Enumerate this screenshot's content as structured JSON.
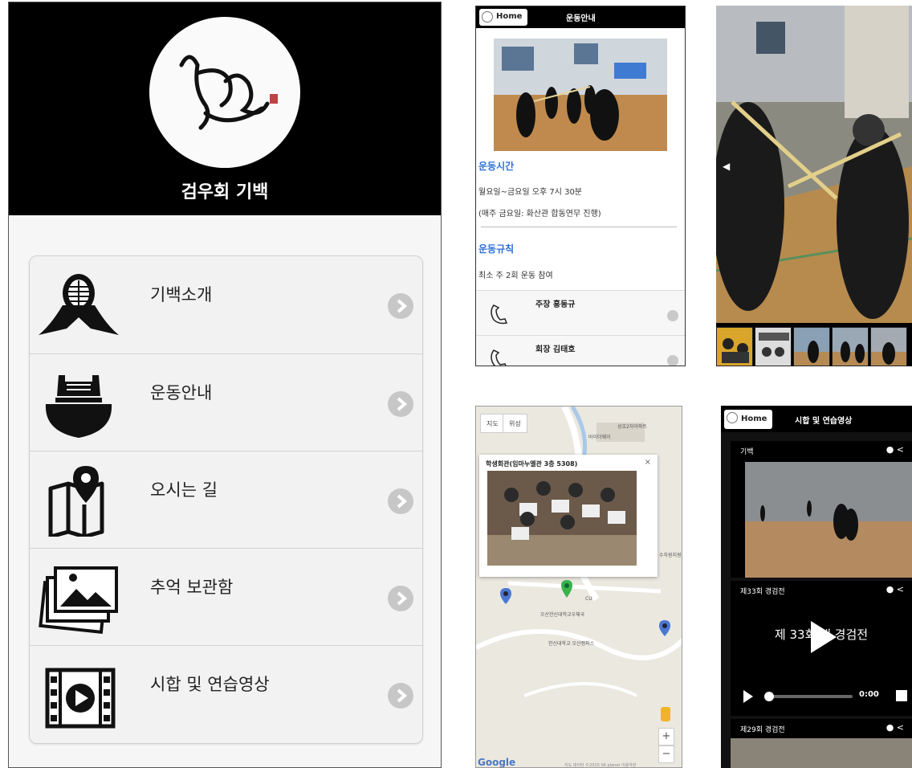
{
  "menu_screen": {
    "club_name": "검우회 기백",
    "items": [
      {
        "label": "기백소개",
        "icon": "kendo-mask-icon"
      },
      {
        "label": "운동안내",
        "icon": "kendo-armor-icon"
      },
      {
        "label": "오시는 길",
        "icon": "map-pin-icon"
      },
      {
        "label": "추억 보관함",
        "icon": "photo-album-icon"
      },
      {
        "label": "시합 및 연습영상",
        "icon": "video-icon"
      }
    ]
  },
  "info_screen": {
    "home_label": "Home",
    "title": "운동안내",
    "time_heading": "운동시간",
    "time_line1": "월요일~금요일 오후 7시 30분",
    "time_line2": "(매주 금요일: 화산관 합동연무 진행)",
    "rule_heading": "운동규칙",
    "rule_line1": "최소 주 2회 운동 참여",
    "contacts": [
      {
        "name": "주장 홍동규"
      },
      {
        "name": "회장 김태호"
      }
    ]
  },
  "gallery_screen": {
    "prev_label": "◀"
  },
  "map_screen": {
    "map_btn": "지도",
    "satellite_btn": "위성",
    "popup_title": "학생회관(임마누엘관 3층 5308)",
    "close": "×",
    "places": {
      "p1": "성호2차아파트",
      "p2": "바이더웨이",
      "p3": "CU",
      "p4": "오산한신대학교우체국",
      "p5": "한신대학교 오산캠퍼스",
      "p6": "수자원지원"
    },
    "zoom_in": "+",
    "zoom_out": "−",
    "google": "Google",
    "copyright": "지도 데이터 ©2015 SK planet    이용약관"
  },
  "video_screen": {
    "home_label": "Home",
    "title": "시합 및 연습영상",
    "videos": [
      {
        "title": "기백"
      },
      {
        "title": "제33회 경검전",
        "overlay": "제 33회 대 경검전",
        "time": "0:00"
      },
      {
        "title": "제29회 경검전"
      }
    ]
  }
}
